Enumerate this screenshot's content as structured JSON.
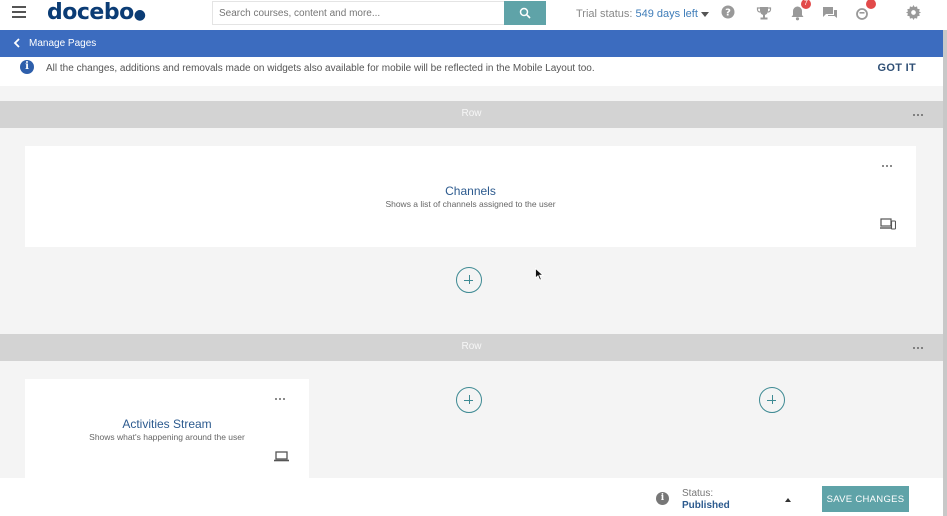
{
  "header": {
    "logo_text": "docebo",
    "search_placeholder": "Search courses, content and more...",
    "trial_prefix": "Trial status:",
    "trial_days": "549 days left",
    "icons": [
      "menu-icon",
      "search-icon",
      "help-icon",
      "trophy-icon",
      "bell-icon",
      "chat-icon",
      "shopping-icon",
      "gear-icon"
    ],
    "notification_count": "7",
    "accent_color": "#5fa3a8"
  },
  "subheader": {
    "back_label": "Manage Pages",
    "color": "#3c6cbf"
  },
  "notice": {
    "text": "All the changes, additions and removals made on widgets also available for mobile will be reflected in the Mobile Layout too.",
    "action": "GOT IT"
  },
  "rows": [
    {
      "label": "Row",
      "widgets": [
        {
          "title": "Channels",
          "description": "Shows a list of channels assigned to the user",
          "device_icon": "devices-icon"
        }
      ]
    },
    {
      "label": "Row",
      "widgets": [
        {
          "title": "Activities Stream",
          "description": "Shows what's happening around the user",
          "device_icon": "laptop-icon"
        }
      ]
    }
  ],
  "footer": {
    "status_label": "Status:",
    "status_value": "Published",
    "save_label": "SAVE CHANGES"
  }
}
